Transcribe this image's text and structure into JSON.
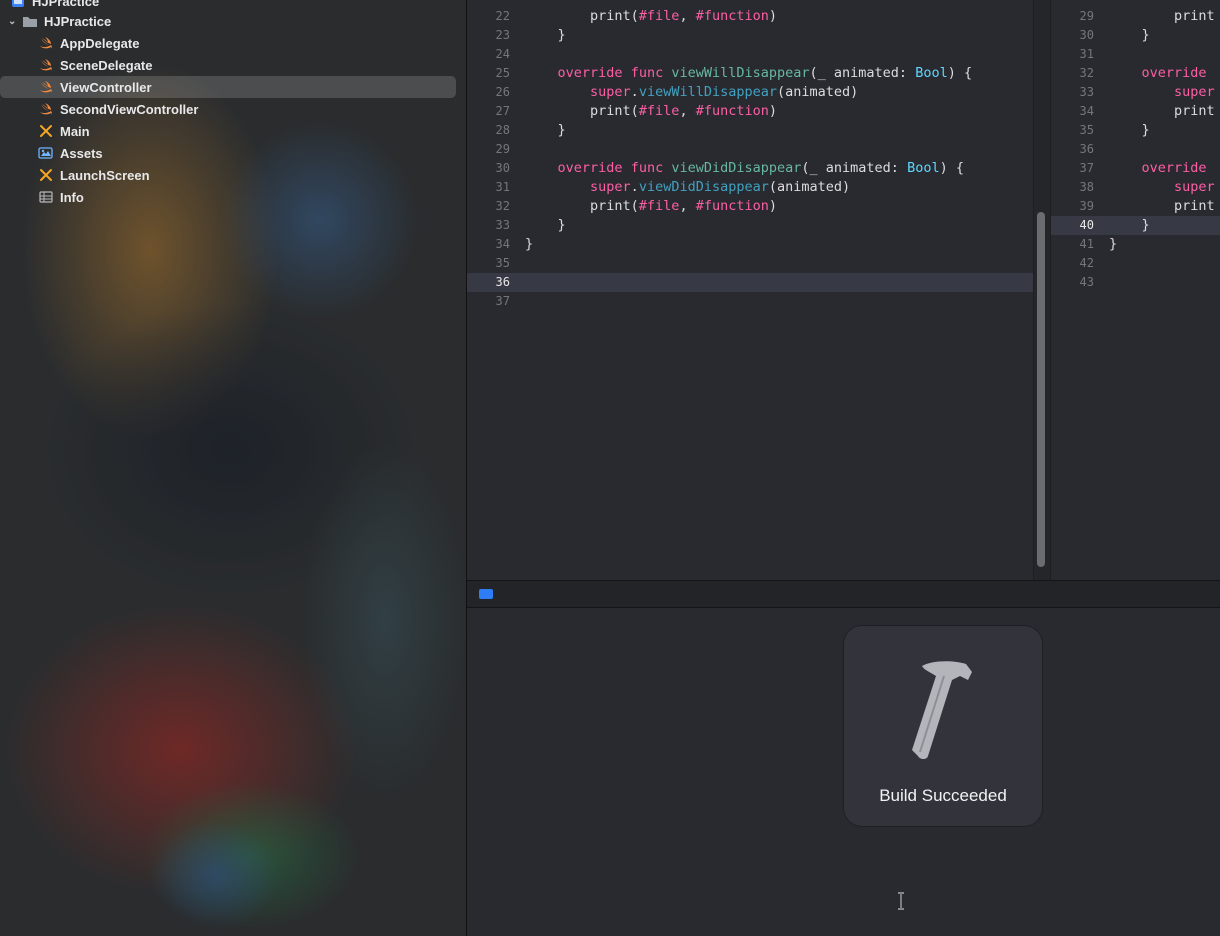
{
  "navigator": {
    "project_name": "HJPractice",
    "group_name": "HJPractice",
    "items": [
      {
        "label": "AppDelegate",
        "icon": "swift-file-icon",
        "selected": false
      },
      {
        "label": "SceneDelegate",
        "icon": "swift-file-icon",
        "selected": false
      },
      {
        "label": "ViewController",
        "icon": "swift-file-icon",
        "selected": true
      },
      {
        "label": "SecondViewController",
        "icon": "swift-file-icon",
        "selected": false
      },
      {
        "label": "Main",
        "icon": "storyboard-icon",
        "selected": false
      },
      {
        "label": "Assets",
        "icon": "asset-catalog-icon",
        "selected": false
      },
      {
        "label": "LaunchScreen",
        "icon": "storyboard-icon",
        "selected": false
      },
      {
        "label": "Info",
        "icon": "plist-icon",
        "selected": false
      }
    ]
  },
  "editor_left": {
    "current_line": "36",
    "lines": [
      {
        "n": "22",
        "text": "        print(#file, #function)"
      },
      {
        "n": "23",
        "text": "    }"
      },
      {
        "n": "24",
        "text": ""
      },
      {
        "n": "25",
        "text": "    override func viewWillDisappear(_ animated: Bool) {"
      },
      {
        "n": "26",
        "text": "        super.viewWillDisappear(animated)"
      },
      {
        "n": "27",
        "text": "        print(#file, #function)"
      },
      {
        "n": "28",
        "text": "    }"
      },
      {
        "n": "29",
        "text": ""
      },
      {
        "n": "30",
        "text": "    override func viewDidDisappear(_ animated: Bool) {"
      },
      {
        "n": "31",
        "text": "        super.viewDidDisappear(animated)"
      },
      {
        "n": "32",
        "text": "        print(#file, #function)"
      },
      {
        "n": "33",
        "text": "    }"
      },
      {
        "n": "34",
        "text": "}"
      },
      {
        "n": "35",
        "text": ""
      },
      {
        "n": "36",
        "text": ""
      },
      {
        "n": "37",
        "text": ""
      }
    ]
  },
  "editor_right": {
    "current_line": "40",
    "lines": [
      {
        "n": "29",
        "text": "        print"
      },
      {
        "n": "30",
        "text": "    }"
      },
      {
        "n": "31",
        "text": ""
      },
      {
        "n": "32",
        "text": "    override"
      },
      {
        "n": "33",
        "text": "        super"
      },
      {
        "n": "34",
        "text": "        print"
      },
      {
        "n": "35",
        "text": "    }"
      },
      {
        "n": "36",
        "text": ""
      },
      {
        "n": "37",
        "text": "    override"
      },
      {
        "n": "38",
        "text": "        super"
      },
      {
        "n": "39",
        "text": "        print"
      },
      {
        "n": "40",
        "text": "    }"
      },
      {
        "n": "41",
        "text": "}"
      },
      {
        "n": "42",
        "text": ""
      },
      {
        "n": "43",
        "text": ""
      }
    ]
  },
  "hud": {
    "message": "Build Succeeded",
    "icon": "hammer-icon"
  },
  "colors": {
    "keyword": "#fc5fa3",
    "type": "#5dd8ff",
    "function_name": "#67b7a4",
    "method_call": "#41a1c0",
    "swift_icon": "#f0883e",
    "debug_toggle": "#2e7cf6"
  }
}
